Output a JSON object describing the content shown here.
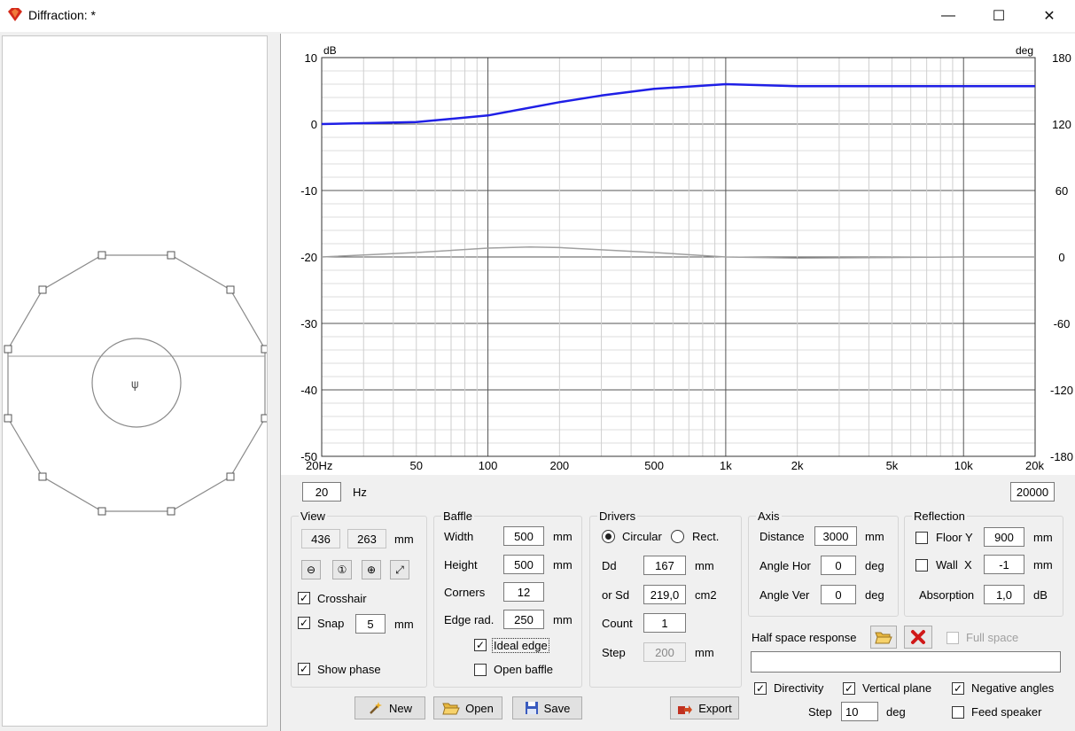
{
  "window": {
    "title": "Diffraction: *",
    "minimize": "—",
    "maximize": "☐",
    "close": "✕"
  },
  "graph": {
    "left_unit": "dB",
    "right_unit": "deg",
    "left_ticks": [
      "10",
      "0",
      "-10",
      "-20",
      "-30",
      "-40",
      "-50"
    ],
    "right_ticks": [
      "180",
      "120",
      "60",
      "0",
      "-60",
      "-120",
      "-180"
    ],
    "x_ticks": [
      "20Hz",
      "50",
      "100",
      "200",
      "500",
      "1k",
      "2k",
      "5k",
      "10k",
      "20k"
    ],
    "freq_min": "20",
    "freq_unit": "Hz",
    "freq_max": "20000"
  },
  "chart_data": {
    "type": "line",
    "x_scale": "log",
    "xlim": [
      20,
      20000
    ],
    "ylim": [
      -50,
      10
    ],
    "y2lim": [
      -180,
      180
    ],
    "series": [
      {
        "axis": "left",
        "color": "#1f1fe6",
        "x": [
          20,
          50,
          100,
          200,
          300,
          500,
          1000,
          2000,
          5000,
          10000,
          20000
        ],
        "y": [
          0,
          0.3,
          1.3,
          3.3,
          4.3,
          5.3,
          6.0,
          5.7,
          5.7,
          5.7,
          5.7
        ]
      },
      {
        "axis": "right",
        "color": "#a0a0a0",
        "x": [
          20,
          50,
          100,
          150,
          200,
          500,
          1000,
          2000,
          5000,
          10000,
          20000
        ],
        "y": [
          0,
          4,
          8,
          9,
          8.5,
          4,
          0,
          -1,
          -0.5,
          0,
          0
        ]
      }
    ]
  },
  "view": {
    "title": "View",
    "width": "436",
    "height": "263",
    "unit": "mm",
    "crosshair": "Crosshair",
    "snap": "Snap",
    "snap_value": "5",
    "snap_unit": "mm",
    "show_phase": "Show phase"
  },
  "baffle": {
    "title": "Baffle",
    "width_label": "Width",
    "width": "500",
    "height_label": "Height",
    "height": "500",
    "corners_label": "Corners",
    "corners": "12",
    "edge_label": "Edge rad.",
    "edge": "250",
    "unit": "mm",
    "ideal_edge": "Ideal edge",
    "open_baffle": "Open baffle"
  },
  "drivers": {
    "title": "Drivers",
    "circular": "Circular",
    "rect": "Rect.",
    "dd_label": "Dd",
    "dd": "167",
    "dd_unit": "mm",
    "sd_label": "or Sd",
    "sd": "219,0",
    "sd_unit": "cm2",
    "count_label": "Count",
    "count": "1",
    "step_label": "Step",
    "step": "200",
    "step_unit": "mm"
  },
  "axis": {
    "title": "Axis",
    "distance_label": "Distance",
    "distance": "3000",
    "distance_unit": "mm",
    "angle_hor_label": "Angle Hor",
    "angle_hor": "0",
    "angle_ver_label": "Angle Ver",
    "angle_ver": "0",
    "deg": "deg"
  },
  "reflection": {
    "title": "Reflection",
    "floor_label": "Floor Y",
    "floor": "900",
    "wall_label": "Wall  X",
    "wall": "-1",
    "unit": "mm",
    "absorption_label": "Absorption",
    "absorption": "1,0",
    "absorption_unit": "dB"
  },
  "half_space": {
    "label": "Half space response",
    "full_space": "Full space",
    "path": ""
  },
  "options": {
    "directivity": "Directivity",
    "vertical_plane": "Vertical plane",
    "negative_angles": "Negative angles",
    "step_label": "Step",
    "step": "10",
    "step_unit": "deg",
    "feed_speaker": "Feed speaker"
  },
  "buttons": {
    "new": "New",
    "open": "Open",
    "save": "Save",
    "export": "Export"
  }
}
